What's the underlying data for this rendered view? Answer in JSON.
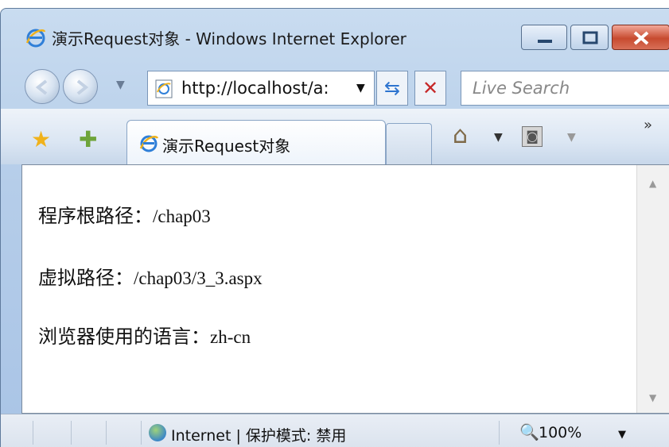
{
  "window": {
    "title": "演示Request对象 - Windows Internet Explorer"
  },
  "toolbar": {
    "address": "http://localhost/a:",
    "search_placeholder": "Live Search",
    "tab_title": "演示Request对象"
  },
  "content": {
    "lines": [
      {
        "label": "程序根路径：",
        "value": "/chap03"
      },
      {
        "label": "虚拟路径：",
        "value": "/chap03/3_3.aspx"
      },
      {
        "label": "浏览器使用的语言：",
        "value": "zh-cn"
      }
    ]
  },
  "statusbar": {
    "zone": "Internet | 保护模式: 禁用",
    "zoom": "100%"
  },
  "icons": {
    "ie": "ie-logo-icon",
    "back": "back-arrow-icon",
    "forward": "forward-arrow-icon",
    "refresh": "refresh-icon",
    "stop": "stop-icon",
    "favorites": "star-icon",
    "add_favorites": "add-favorites-icon",
    "home": "home-icon",
    "feeds": "rss-feed-icon",
    "internet_zone": "globe-icon",
    "zoom": "zoom-icon"
  },
  "colors": {
    "chrome": "#b5cde9",
    "close_button": "#c74b2f"
  }
}
